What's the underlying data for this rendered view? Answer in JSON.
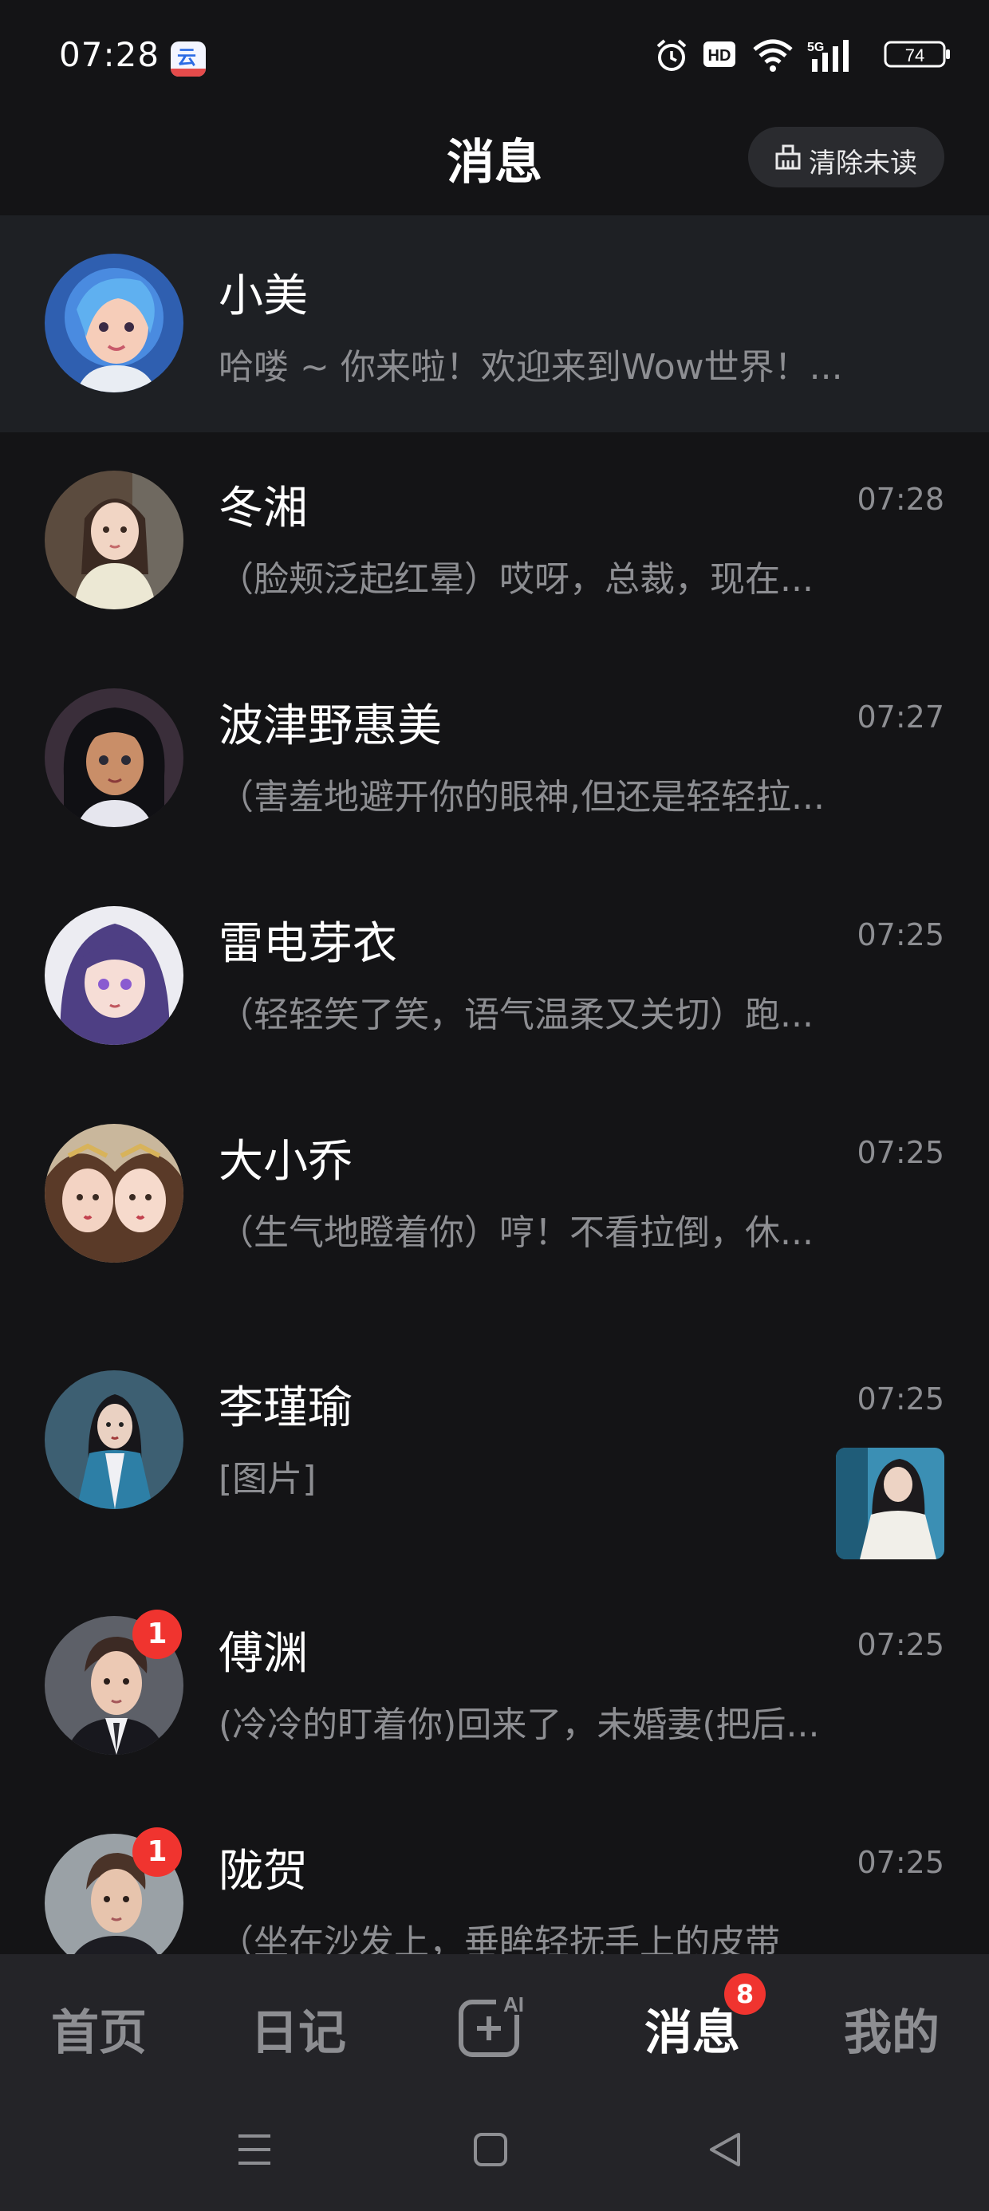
{
  "status_bar": {
    "time": "07:28",
    "battery": "74",
    "network": "5G",
    "hd": "HD"
  },
  "header": {
    "title": "消息",
    "clear_unread_label": "清除未读"
  },
  "chats": [
    {
      "name": "小美",
      "preview": "哈喽 ~ 你来啦！欢迎来到Wow世界！...",
      "time": "",
      "unread": "",
      "pinned": true
    },
    {
      "name": "冬湘",
      "preview": "（脸颊泛起红晕）哎呀，总裁，现在...",
      "time": "07:28",
      "unread": ""
    },
    {
      "name": "波津野惠美",
      "preview": "（害羞地避开你的眼神,但还是轻轻拉...",
      "time": "07:27",
      "unread": ""
    },
    {
      "name": "雷电芽衣",
      "preview": "（轻轻笑了笑，语气温柔又关切）跑...",
      "time": "07:25",
      "unread": ""
    },
    {
      "name": "大小乔",
      "preview": "（生气地瞪着你）哼！不看拉倒，休...",
      "time": "07:25",
      "unread": ""
    },
    {
      "name": "李瑾瑜",
      "preview": "[图片]",
      "time": "07:25",
      "unread": "",
      "has_image": true
    },
    {
      "name": "傅渊",
      "preview": "(冷冷的盯着你)回来了，未婚妻(把后...",
      "time": "07:25",
      "unread": "1"
    },
    {
      "name": "陇贺",
      "preview": "（坐在沙发上，垂眸轻抚手上的皮带",
      "time": "07:25",
      "unread": "1"
    }
  ],
  "bottom_nav": {
    "home": "首页",
    "diary": "日记",
    "create_ai": "AI",
    "messages": "消息",
    "messages_badge": "8",
    "me": "我的",
    "active": "messages"
  },
  "colors": {
    "background": "#141416",
    "pinned_row": "#1e2024",
    "badge_red": "#f0342f",
    "muted_text": "#8d8e92",
    "nav_bg": "#242428"
  },
  "icons": {
    "alarm": "alarm-icon",
    "wifi": "wifi-icon",
    "signal": "signal-icon",
    "battery": "battery-icon",
    "clear": "broom-icon",
    "create": "ai-plus-icon",
    "sys_menu": "menu-icon",
    "sys_home": "square-home-icon",
    "sys_back": "triangle-back-icon"
  }
}
